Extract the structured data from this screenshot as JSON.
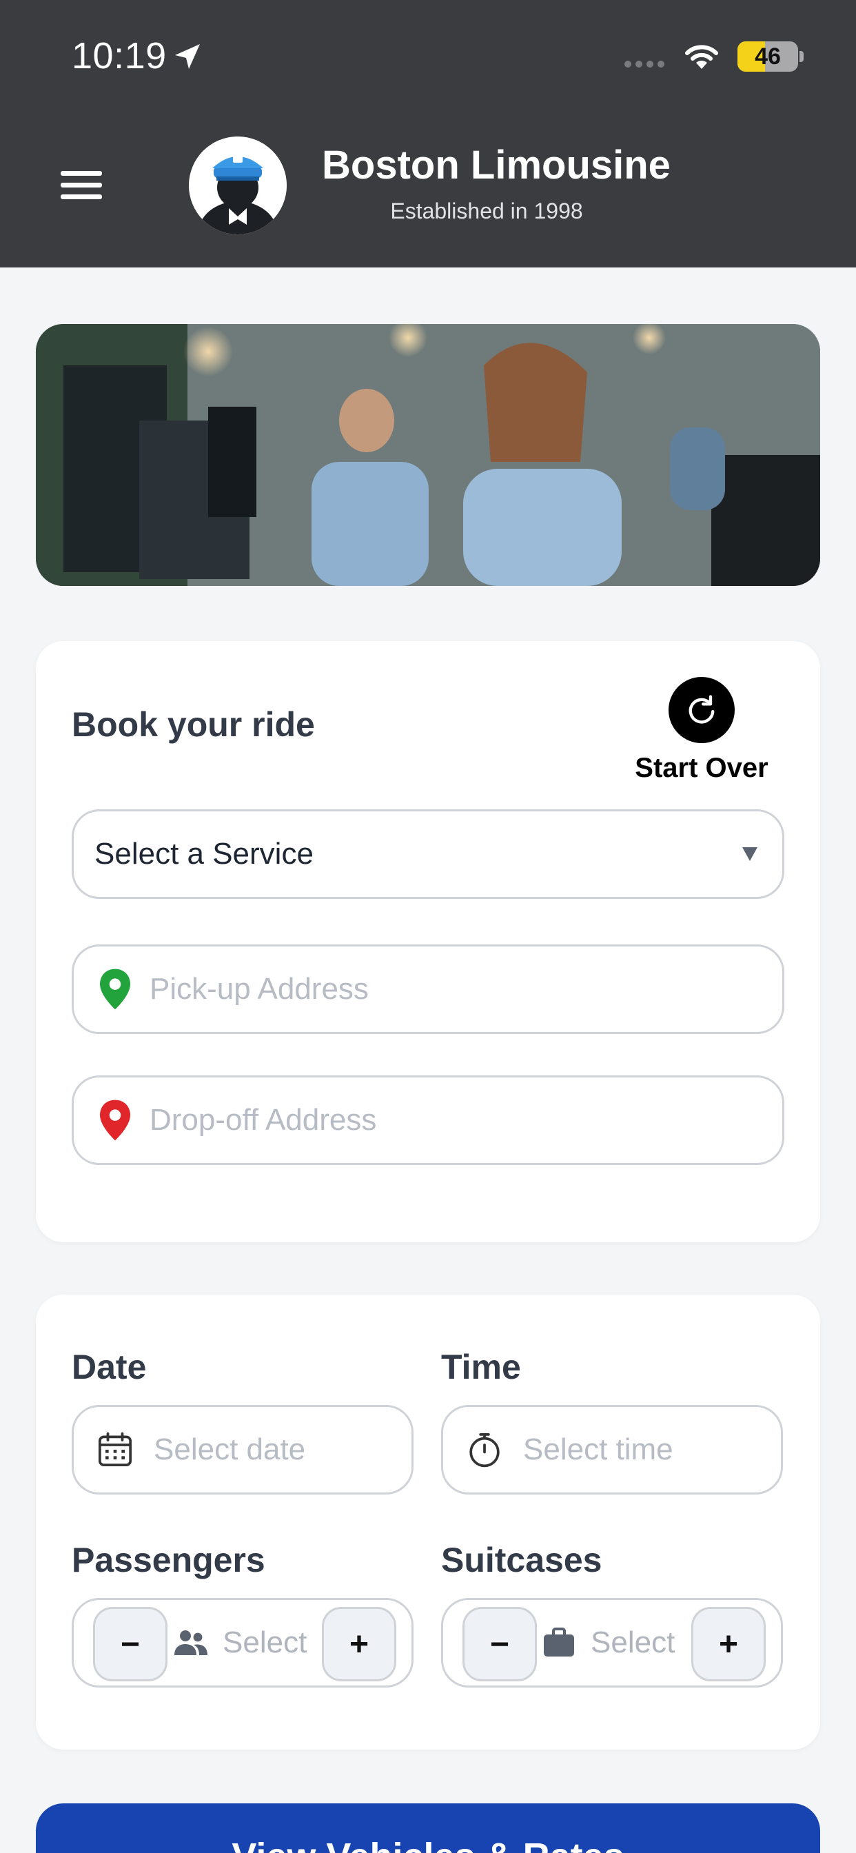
{
  "status_bar": {
    "time": "10:19",
    "battery": "46",
    "battery_level_percent": 46
  },
  "header": {
    "title": "Boston Limousine",
    "subtitle": "Established in 1998"
  },
  "colors": {
    "header_bg": "#3b3c3f",
    "primary_button": "#1744b0",
    "pickup_pin": "#22a33b",
    "dropoff_pin": "#e0262b"
  },
  "booking": {
    "title": "Book your ride",
    "start_over_label": "Start Over",
    "service_select": "Select a Service",
    "pickup_placeholder": "Pick-up Address",
    "dropoff_placeholder": "Drop-off Address"
  },
  "details": {
    "date_label": "Date",
    "date_placeholder": "Select date",
    "time_label": "Time",
    "time_placeholder": "Select time",
    "passengers_label": "Passengers",
    "passengers_placeholder": "Select",
    "suitcases_label": "Suitcases",
    "suitcases_placeholder": "Select",
    "minus": "−",
    "plus": "+"
  },
  "cta": {
    "label": "View Vehicles & Rates"
  },
  "icons": [
    "location-arrow-icon",
    "wifi-icon",
    "battery-icon",
    "menu-icon",
    "chauffeur-avatar-icon",
    "refresh-icon",
    "chevron-down-icon",
    "map-pin-icon",
    "calendar-icon",
    "stopwatch-icon",
    "people-icon",
    "suitcase-icon"
  ]
}
